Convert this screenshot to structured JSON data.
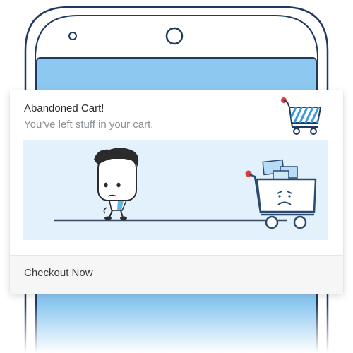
{
  "notification": {
    "title": "Abandoned Cart!",
    "message": "You’ve left stuff in your cart.",
    "action_label": "Checkout Now",
    "icon": "shopping-cart-icon",
    "illustration": "sad-cart-illustration"
  },
  "colors": {
    "outline": "#1f3a5f",
    "screen": "#8cc8ef",
    "banner": "#e2f1fb",
    "accent_blue": "#3a9ad9",
    "badge_red": "#e03b3b",
    "scarf": "#5bb8e8"
  }
}
